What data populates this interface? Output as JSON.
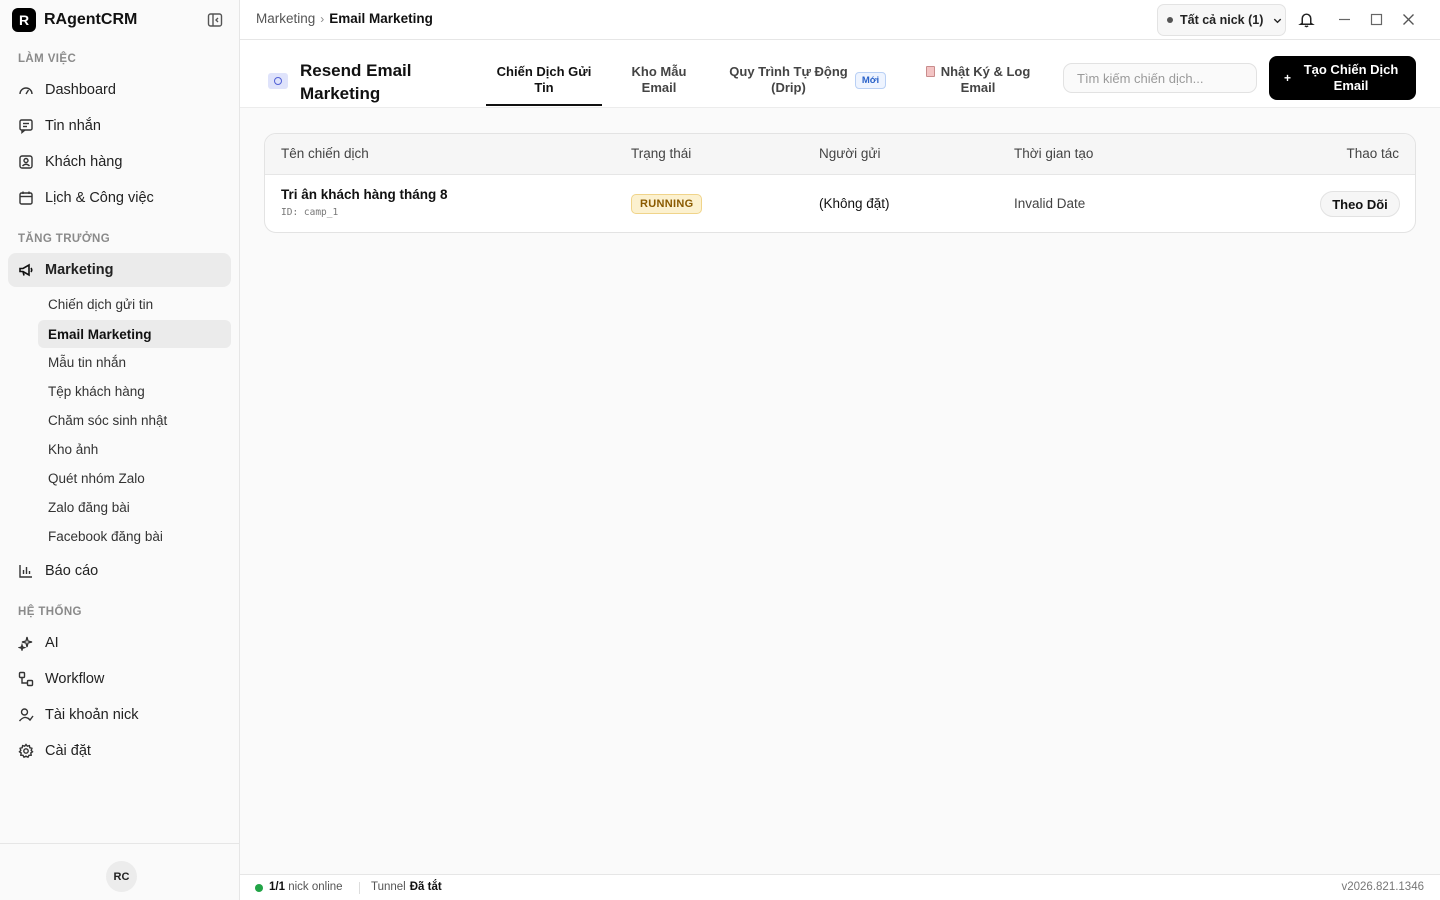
{
  "app": {
    "logo_letter": "R",
    "name": "RAgentCRM"
  },
  "sidebar": {
    "sections": [
      "LÀM VIỆC",
      "TĂNG TRƯỞNG",
      "HỆ THỐNG"
    ],
    "work_items": [
      "Dashboard",
      "Tin nhắn",
      "Khách hàng",
      "Lịch & Công việc"
    ],
    "growth_item": "Marketing",
    "marketing_subitems": [
      "Chiến dịch gửi tin",
      "Email Marketing",
      "Mẫu tin nhắn",
      "Tệp khách hàng",
      "Chăm sóc sinh nhật",
      "Kho ảnh",
      "Quét nhóm Zalo",
      "Zalo đăng bài",
      "Facebook đăng bài"
    ],
    "report_item": "Báo cáo",
    "system_items": [
      "AI",
      "Workflow",
      "Tài khoản nick",
      "Cài đặt"
    ],
    "avatar_initials": "RC"
  },
  "topbar": {
    "breadcrumb_parent": "Marketing",
    "breadcrumb_separator": "›",
    "breadcrumb_current": "Email Marketing",
    "nick_select": "Tất cả nick (1)"
  },
  "header": {
    "title": "Resend Email Marketing",
    "tabs": [
      "Chiến Dịch Gửi Tin",
      "Kho Mẫu Email",
      "Quy Trình Tự Động (Drip)",
      "Nhật Ký & Log Email"
    ],
    "new_badge": "Mới",
    "search_placeholder": "Tìm kiếm chiến dịch...",
    "create_button": "Tạo Chiến Dịch Email",
    "create_button_icon": "+"
  },
  "table": {
    "columns": [
      "Tên chiến dịch",
      "Trạng thái",
      "Người gửi",
      "Thời gian tạo",
      "Thao tác"
    ],
    "rows": [
      {
        "name": "Tri ân khách hàng tháng 8",
        "id": "ID: camp_1",
        "status": "RUNNING",
        "sender": "(Không đặt)",
        "created": "Invalid Date",
        "action": "Theo Dõi"
      }
    ]
  },
  "statusbar": {
    "online_count": "1/1",
    "online_label": "nick online",
    "tunnel_label": "Tunnel",
    "tunnel_value": "Đã tắt",
    "version": "v2026.821.1346"
  },
  "colors": {
    "accent": "#000000",
    "online": "#22a447",
    "status_running_bg": "#fcf1cf",
    "status_running_text": "#8a5a00"
  },
  "icons": [
    "sidebar-collapse-icon",
    "dashboard-icon",
    "message-icon",
    "customer-icon",
    "calendar-icon",
    "megaphone-icon",
    "chart-icon",
    "ai-sparkle-icon",
    "workflow-icon",
    "user-account-icon",
    "gear-icon",
    "chevron-down-icon",
    "bell-icon",
    "minimize-icon",
    "maximize-icon",
    "close-icon",
    "email-icon",
    "log-icon"
  ]
}
